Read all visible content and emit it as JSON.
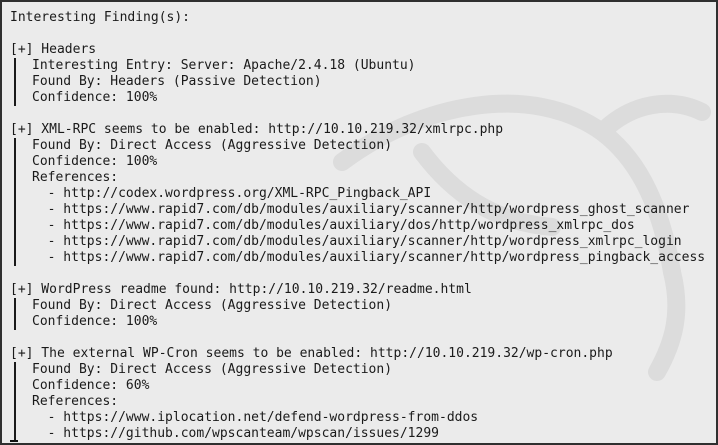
{
  "header": "Interesting Finding(s):",
  "findings": [
    {
      "title": "[+] Headers",
      "details": [
        "Interesting Entry: Server: Apache/2.4.18 (Ubuntu)",
        "Found By: Headers (Passive Detection)",
        "Confidence: 100%"
      ]
    },
    {
      "title": "[+] XML-RPC seems to be enabled: http://10.10.219.32/xmlrpc.php",
      "details": [
        "Found By: Direct Access (Aggressive Detection)",
        "Confidence: 100%",
        "References:"
      ],
      "refs": [
        "- http://codex.wordpress.org/XML-RPC_Pingback_API",
        "- https://www.rapid7.com/db/modules/auxiliary/scanner/http/wordpress_ghost_scanner",
        "- https://www.rapid7.com/db/modules/auxiliary/dos/http/wordpress_xmlrpc_dos",
        "- https://www.rapid7.com/db/modules/auxiliary/scanner/http/wordpress_xmlrpc_login",
        "- https://www.rapid7.com/db/modules/auxiliary/scanner/http/wordpress_pingback_access"
      ]
    },
    {
      "title": "[+] WordPress readme found: http://10.10.219.32/readme.html",
      "details": [
        "Found By: Direct Access (Aggressive Detection)",
        "Confidence: 100%"
      ]
    },
    {
      "title": "[+] The external WP-Cron seems to be enabled: http://10.10.219.32/wp-cron.php",
      "details": [
        "Found By: Direct Access (Aggressive Detection)",
        "Confidence: 60%",
        "References:"
      ],
      "refs": [
        "- https://www.iplocation.net/defend-wordpress-from-ddos",
        "- https://github.com/wpscanteam/wpscan/issues/1299"
      ]
    }
  ]
}
